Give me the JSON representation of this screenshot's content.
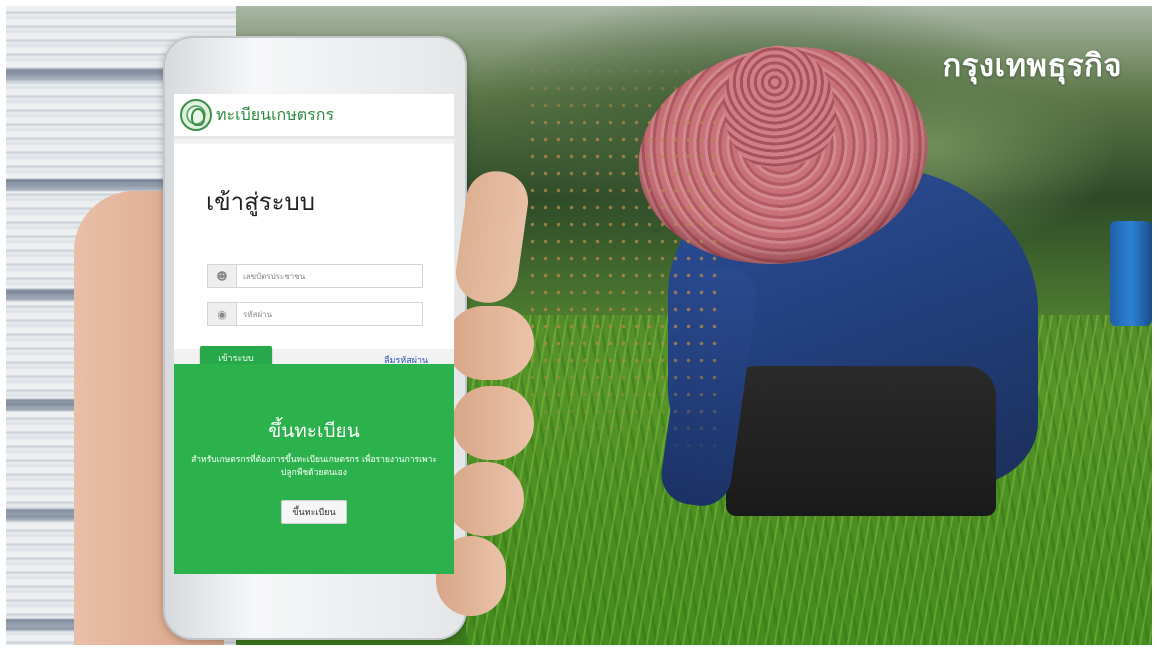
{
  "brand": {
    "text": "กรุงเทพธุรกิจ"
  },
  "app": {
    "title": "ทะเบียนเกษตรกร",
    "logo_icon": "ministry-seal-icon"
  },
  "login": {
    "heading": "เข้าสู่ระบบ",
    "id_placeholder": "เลขบัตรประชาชน",
    "id_icon": "user-icon",
    "password_placeholder": "รหัสผ่าน",
    "password_icon": "lock-icon",
    "submit_label": "เข้าระบบ",
    "forgot_label": "ลืมรหัสผ่าน"
  },
  "register": {
    "heading": "ขึ้นทะเบียน",
    "description": "สำหรับเกษตรกรที่ต้องการขึ้นทะเบียนเกษตรกร เพื่อรายงานการเพาะปลูกพืชด้วยตนเอง",
    "button_label": "ขึ้นทะเบียน"
  },
  "colors": {
    "accent_green": "#2bb24c",
    "link_blue": "#2b4fb8"
  }
}
